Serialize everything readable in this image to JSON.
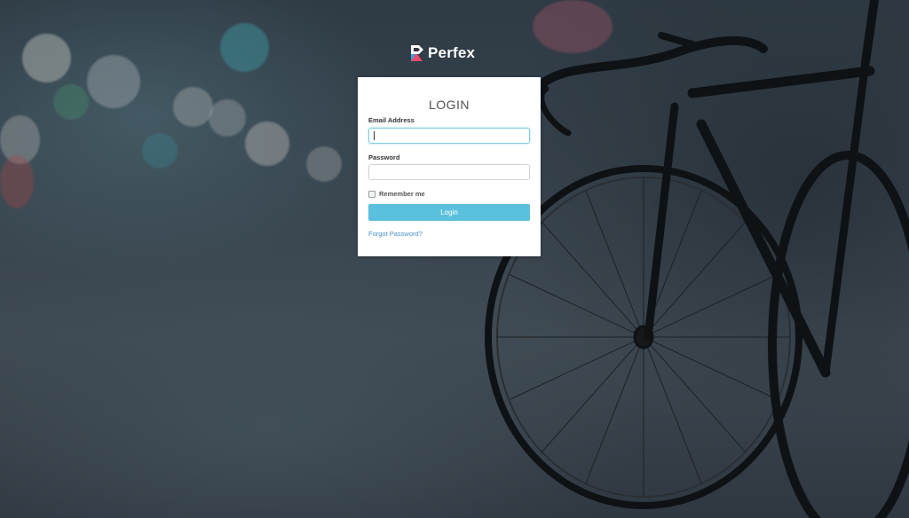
{
  "brand": {
    "name": "Perfex",
    "logo_icon": "perfex-logo-icon",
    "logo_colors": [
      "#ffffff",
      "#3aa3d8",
      "#e74b6d"
    ]
  },
  "login_form": {
    "title": "LOGIN",
    "email_label": "Email Address",
    "email_value": "",
    "password_label": "Password",
    "password_value": "",
    "remember_label": "Remember me",
    "remember_checked": false,
    "submit_label": "Login",
    "forgot_label": "Forgot Password?"
  },
  "colors": {
    "accent": "#5bc0de",
    "link": "#4b8fc9",
    "focus_border": "#7fcfe1"
  }
}
